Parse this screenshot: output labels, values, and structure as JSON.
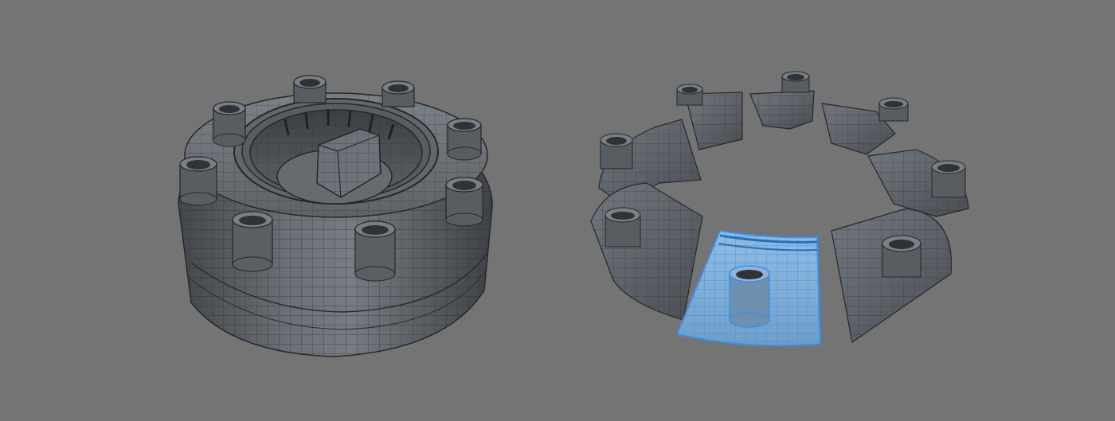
{
  "viewport": {
    "background": "#747474"
  },
  "scene": {
    "mesh_color": "#5c6166",
    "mesh_dark": "#3a3e42",
    "mesh_light": "#8a9097",
    "wire_color": "#1e2124",
    "selection_color": "#4aa3ff",
    "selection_fill": "#7fb8e8",
    "models": [
      {
        "name": "assembled-ring-model",
        "bosses": 8
      },
      {
        "name": "exploded-ring-model",
        "segments": 8,
        "selected_segment": "front"
      }
    ]
  }
}
